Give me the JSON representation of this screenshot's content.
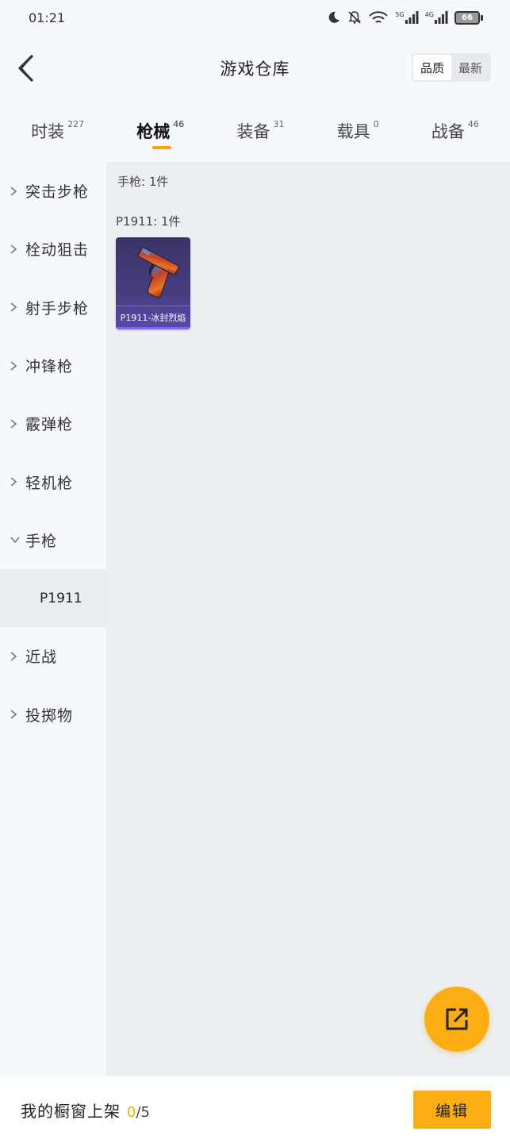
{
  "status_bar": {
    "time": "01:21",
    "signal1_label": "5G",
    "signal2_label": "4G",
    "battery": "66"
  },
  "header": {
    "title": "游戏仓库",
    "sort_options": [
      "品质",
      "最新"
    ]
  },
  "tabs": [
    {
      "label": "时装",
      "count": "227"
    },
    {
      "label": "枪械",
      "count": "46"
    },
    {
      "label": "装备",
      "count": "31"
    },
    {
      "label": "载具",
      "count": "0"
    },
    {
      "label": "战备",
      "count": "46"
    }
  ],
  "sidebar": {
    "items": [
      {
        "label": "突击步枪"
      },
      {
        "label": "栓动狙击"
      },
      {
        "label": "射手步枪"
      },
      {
        "label": "冲锋枪"
      },
      {
        "label": "霰弹枪"
      },
      {
        "label": "轻机枪"
      },
      {
        "label": "手枪"
      },
      {
        "label": "近战"
      },
      {
        "label": "投掷物"
      }
    ],
    "expanded_sub": "P1911"
  },
  "content": {
    "group_title": "手枪: 1件",
    "sub_title": "P1911: 1件",
    "item": {
      "label": "P1911-冰封烈焰"
    }
  },
  "bottom_bar": {
    "label": "我的橱窗上架",
    "count_current": "0",
    "count_sep_total": "/5",
    "edit_label": "编辑"
  },
  "colors": {
    "accent": "#fbad12",
    "count_highlight": "#f2b300",
    "card_bg": "#463d80"
  }
}
